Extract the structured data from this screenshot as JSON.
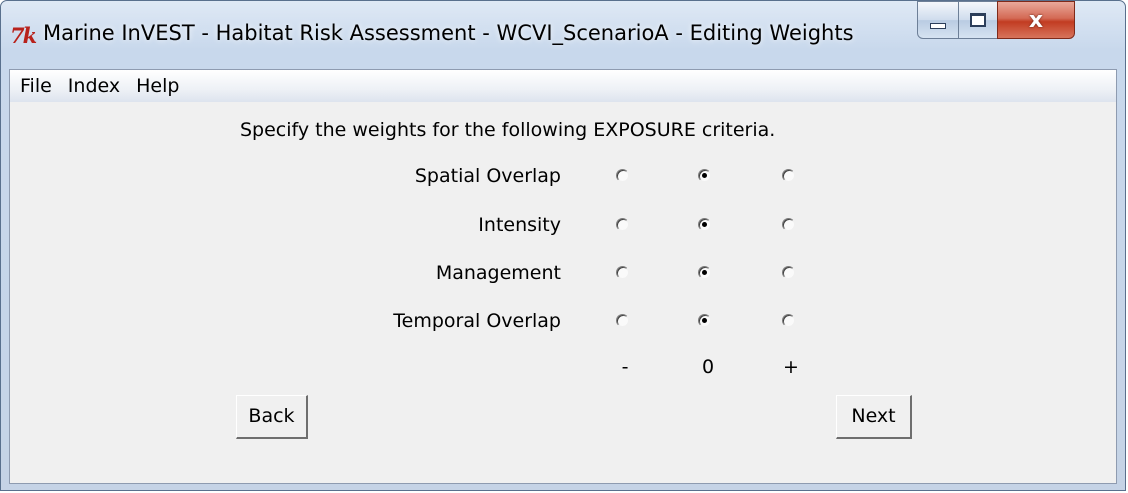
{
  "window": {
    "title": "Marine InVEST - Habitat Risk Assessment - WCVI_ScenarioA - Editing Weights",
    "logo_text": "7k",
    "close_glyph": "x"
  },
  "menu": {
    "items": [
      "File",
      "Index",
      "Help"
    ]
  },
  "main": {
    "instruction": "Specify the weights for the following EXPOSURE criteria.",
    "criteria": [
      {
        "label": "Spatial Overlap",
        "selected": "0"
      },
      {
        "label": "Intensity",
        "selected": "0"
      },
      {
        "label": "Management",
        "selected": "0"
      },
      {
        "label": "Temporal Overlap",
        "selected": "0"
      }
    ],
    "scale": [
      "-",
      "0",
      "+"
    ]
  },
  "buttons": {
    "back": "Back",
    "next": "Next"
  },
  "colors": {
    "frame": "#c5d3e6",
    "client_bg": "#f0f0f0",
    "close_button": "#c23c22",
    "logo": "#b8221c"
  }
}
